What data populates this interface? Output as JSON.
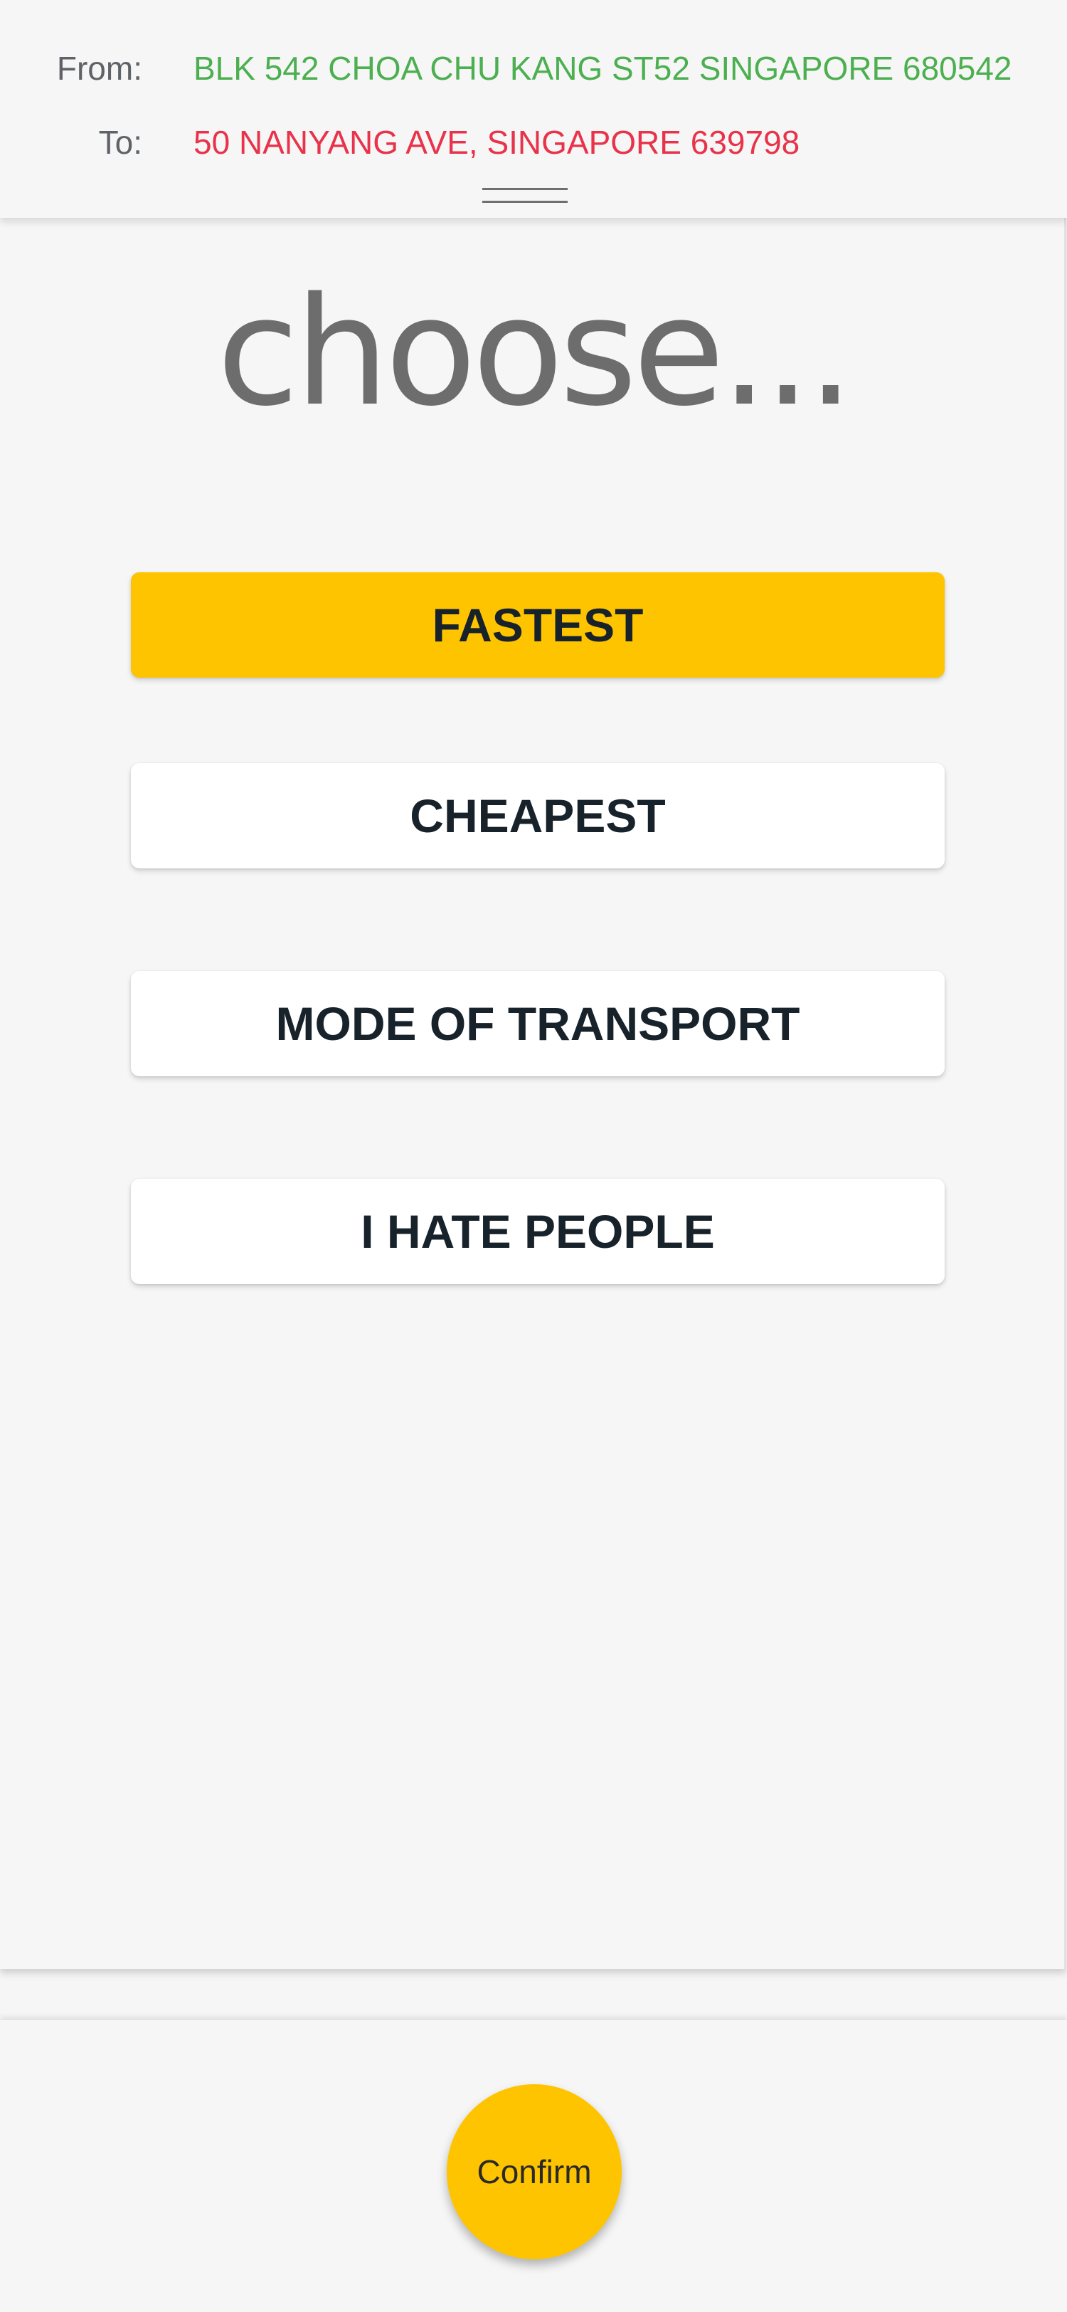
{
  "route": {
    "from_label": "From:",
    "from_value": "BLK 542 CHOA CHU KANG ST52 SINGAPORE 680542",
    "to_label": "To:",
    "to_value": "50 NANYANG AVE, SINGAPORE 639798"
  },
  "colors": {
    "from": "#4caf50",
    "to": "#e8334a",
    "accent": "#ffc400"
  },
  "title": "choose...",
  "options": [
    {
      "label": "FASTEST",
      "selected": true
    },
    {
      "label": "CHEAPEST",
      "selected": false
    },
    {
      "label": "MODE OF TRANSPORT",
      "selected": false
    },
    {
      "label": "I HATE PEOPLE",
      "selected": false
    }
  ],
  "confirm_label": "Confirm"
}
